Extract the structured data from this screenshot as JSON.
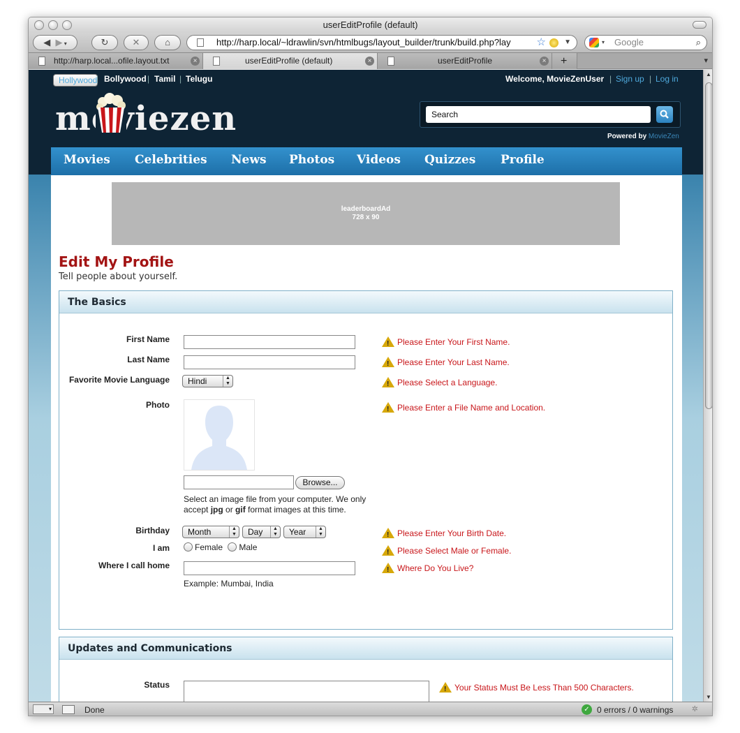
{
  "window": {
    "title": "userEditProfile (default)"
  },
  "toolbar": {
    "url": "http://harp.local/~ldrawlin/svn/htmlbugs/layout_builder/trunk/build.php?lay",
    "search_placeholder": "Google"
  },
  "tabs": [
    {
      "label": "http://harp.local...ofile.layout.txt",
      "active": false
    },
    {
      "label": "userEditProfile (default)",
      "active": true
    },
    {
      "label": "userEditProfile",
      "active": false
    }
  ],
  "site": {
    "languages": [
      "Hollywood",
      "Bollywood",
      "Tamil",
      "Telugu"
    ],
    "welcome": "Welcome, MovieZenUser",
    "signup": "Sign up",
    "login": "Log in",
    "logo": "moviezen",
    "search_value": "Search",
    "powered_by": "Powered by",
    "powered_brand": "MovieZen",
    "nav": [
      "Movies",
      "Celebrities",
      "News",
      "Photos",
      "Videos",
      "Quizzes",
      "Profile"
    ]
  },
  "ad": {
    "label": "leaderboardAd",
    "size": "728 x 90"
  },
  "page": {
    "title": "Edit My Profile",
    "subtitle": "Tell people about yourself."
  },
  "basics": {
    "heading": "The Basics",
    "first_name_label": "First Name",
    "last_name_label": "Last Name",
    "language_label": "Favorite Movie Language",
    "language_value": "Hindi",
    "photo_label": "Photo",
    "browse_label": "Browse...",
    "photo_note_1": "Select an image file from your computer. We only",
    "photo_note_2a": "accept ",
    "photo_note_jpg": "jpg",
    "photo_note_or": " or ",
    "photo_note_gif": "gif",
    "photo_note_2b": " format images at this time.",
    "birthday_label": "Birthday",
    "month": "Month",
    "day": "Day",
    "year": "Year",
    "gender_label": "I am",
    "female": "Female",
    "male": "Male",
    "home_label": "Where I call home",
    "home_example": "Example: Mumbai, India",
    "errors": {
      "first_name": "Please Enter Your First Name.",
      "last_name": "Please Enter Your Last Name.",
      "language": "Please Select a Language.",
      "photo": "Please Enter a File Name and Location.",
      "birthday": "Please Enter Your Birth Date.",
      "gender": "Please Select Male or Female.",
      "home": "Where Do You Live?"
    }
  },
  "updates": {
    "heading": "Updates and Communications",
    "status_label": "Status",
    "status_error": "Your Status Must Be Less Than 500 Characters."
  },
  "statusbar": {
    "status": "Done",
    "errors": "0 errors / 0 warnings"
  },
  "colors": {
    "header_bg": "#0e2435",
    "nav_blue": "#2a86c3",
    "title_red": "#a31414",
    "error_red": "#c8161a",
    "link_blue": "#4fa9dc"
  }
}
